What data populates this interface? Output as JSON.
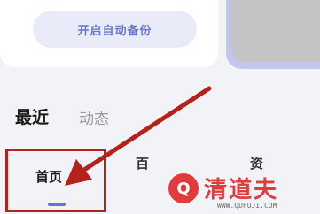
{
  "backup_button": {
    "label": "开启自动备份"
  },
  "section_tabs": [
    {
      "label": "最近"
    },
    {
      "label": "动态"
    }
  ],
  "bottom_nav": {
    "home_label": "首页",
    "item2_partial": "百",
    "item3_partial": "资"
  },
  "watermark": {
    "brand": "清道夫",
    "url": "WWW.QDFUJI.COM",
    "logo_glyph": "Q"
  },
  "colors": {
    "accent": "#6673d4",
    "highlight": "#b5211b",
    "watermark": "#e33b3b"
  },
  "icons": [
    "arrow-annotation-icon",
    "watermark-logo-icon"
  ]
}
